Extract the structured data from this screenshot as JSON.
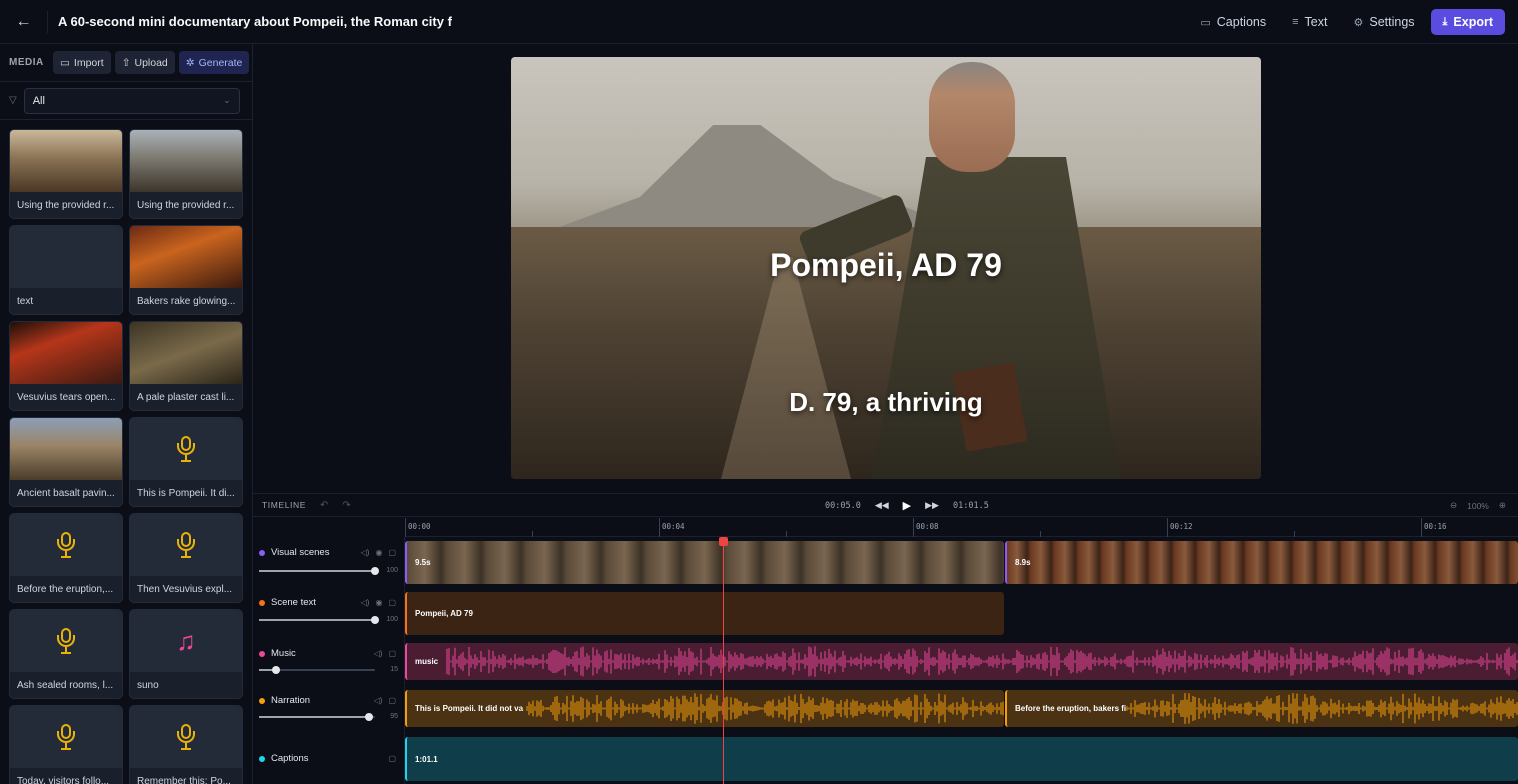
{
  "header": {
    "title": "A 60-second mini documentary about Pompeii, the Roman city f",
    "captions_label": "Captions",
    "text_label": "Text",
    "settings_label": "Settings",
    "export_label": "Export"
  },
  "sidebar": {
    "media_label": "MEDIA",
    "import_label": "Import",
    "upload_label": "Upload",
    "generate_label": "Generate",
    "filter_value": "All",
    "items": [
      {
        "label": "Using the provided r...",
        "kind": "image"
      },
      {
        "label": "Using the provided r...",
        "kind": "image"
      },
      {
        "label": "text",
        "kind": "text"
      },
      {
        "label": "Bakers rake glowing...",
        "kind": "image"
      },
      {
        "label": "Vesuvius tears open...",
        "kind": "image"
      },
      {
        "label": "A pale plaster cast li...",
        "kind": "image"
      },
      {
        "label": "Ancient basalt pavin...",
        "kind": "image"
      },
      {
        "label": "This is Pompeii. It di...",
        "kind": "voice"
      },
      {
        "label": "Before the eruption,...",
        "kind": "voice"
      },
      {
        "label": "Then Vesuvius expl...",
        "kind": "voice"
      },
      {
        "label": "Ash sealed rooms, l...",
        "kind": "voice"
      },
      {
        "label": "suno",
        "kind": "music"
      },
      {
        "label": "Today, visitors follo...",
        "kind": "voice"
      },
      {
        "label": "Remember this: Po...",
        "kind": "voice"
      }
    ]
  },
  "preview": {
    "title_overlay": "Pompeii, AD 79",
    "caption_overlay": "D. 79, a thriving"
  },
  "timeline": {
    "label": "TIMELINE",
    "current_time": "00:05.0",
    "duration": "01:01.5",
    "zoom": "100%",
    "ruler": [
      "00:00",
      "00:04",
      "00:08",
      "00:12",
      "00:16"
    ],
    "tracks": {
      "visual": {
        "name": "Visual scenes",
        "volume": "100",
        "clip1": "9.5s",
        "clip2": "8.9s"
      },
      "scene_text": {
        "name": "Scene text",
        "volume": "100",
        "clip1": "Pompeii, AD 79"
      },
      "music": {
        "name": "Music",
        "volume": "15",
        "clip1": "music"
      },
      "narration": {
        "name": "Narration",
        "volume": "95",
        "clip1": "This is Pompeii. It did not va",
        "clip2": "Before the eruption, bakers fi"
      },
      "captions": {
        "name": "Captions",
        "clip1": "1:01.1"
      }
    }
  },
  "colors": {
    "accent": "#5b4ce0",
    "visual": "#8b5cf6",
    "scene_text": "#f97316",
    "music": "#ec4899",
    "narration": "#f59e0b",
    "captions": "#22d3ee",
    "playhead": "#ef4444"
  }
}
